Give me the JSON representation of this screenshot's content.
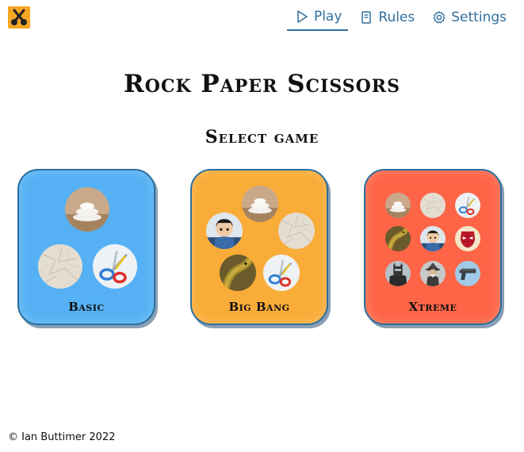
{
  "nav": {
    "items": [
      {
        "label": "Play",
        "icon": "play-icon",
        "active": true
      },
      {
        "label": "Rules",
        "icon": "book-icon",
        "active": false
      },
      {
        "label": "Settings",
        "icon": "gear-icon",
        "active": false
      }
    ]
  },
  "header": {
    "title": "Rock Paper Scissors",
    "subtitle": "Select game"
  },
  "games": [
    {
      "label": "Basic",
      "color": "#55b1f4",
      "items": [
        "rock",
        "paper",
        "scissors"
      ]
    },
    {
      "label": "Big Bang",
      "color": "#f9ac38",
      "items": [
        "rock",
        "spock",
        "paper",
        "lizard",
        "scissors"
      ]
    },
    {
      "label": "Xtreme",
      "color": "#fe6547",
      "items": [
        "rock",
        "paper",
        "scissors",
        "lizard",
        "spock",
        "spider-man",
        "batman",
        "wizard",
        "glock"
      ]
    }
  ],
  "footer": {
    "copyright": "© Ian Buttimer 2022"
  },
  "colors": {
    "accent": "#2e6f9e",
    "logo": "#f5a623"
  }
}
